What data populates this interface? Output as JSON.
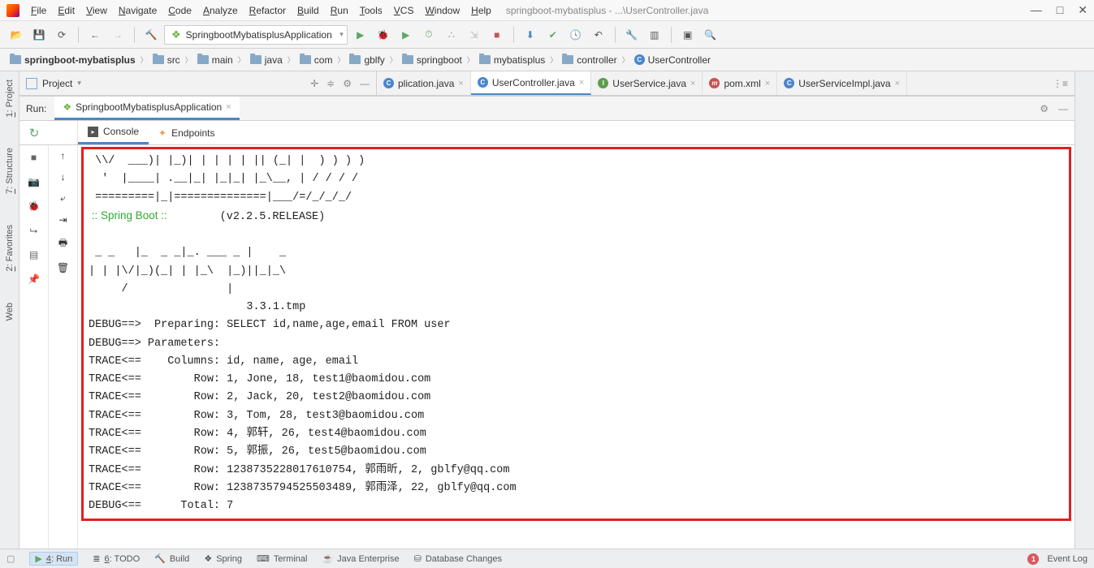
{
  "window": {
    "title_path": "springboot-mybatisplus - ...\\UserController.java"
  },
  "menu": [
    "File",
    "Edit",
    "View",
    "Navigate",
    "Code",
    "Analyze",
    "Refactor",
    "Build",
    "Run",
    "Tools",
    "VCS",
    "Window",
    "Help"
  ],
  "run_config": {
    "name": "SpringbootMybatisplusApplication"
  },
  "breadcrumb": [
    {
      "icon": "root",
      "label": "springboot-mybatisplus"
    },
    {
      "icon": "folder",
      "label": "src"
    },
    {
      "icon": "folder",
      "label": "main"
    },
    {
      "icon": "folder",
      "label": "java"
    },
    {
      "icon": "folder",
      "label": "com"
    },
    {
      "icon": "folder",
      "label": "gblfy"
    },
    {
      "icon": "folder",
      "label": "springboot"
    },
    {
      "icon": "folder",
      "label": "mybatisplus"
    },
    {
      "icon": "folder",
      "label": "controller"
    },
    {
      "icon": "class",
      "label": "UserController"
    }
  ],
  "project_panel": {
    "label": "Project"
  },
  "editor_tabs": [
    {
      "icon": "c",
      "label": "plication.java",
      "active": false,
      "truncated": true
    },
    {
      "icon": "c",
      "label": "UserController.java",
      "active": true
    },
    {
      "icon": "i",
      "label": "UserService.java",
      "active": false
    },
    {
      "icon": "m",
      "label": "pom.xml",
      "active": false
    },
    {
      "icon": "c",
      "label": "UserServiceImpl.java",
      "active": false
    }
  ],
  "left_tabs": [
    {
      "label": "1: Project",
      "tip": "1"
    },
    {
      "label": "7: Structure",
      "tip": "7"
    },
    {
      "label": "2: Favorites",
      "tip": "2"
    },
    {
      "label": "Web",
      "tip": ""
    }
  ],
  "run_panel": {
    "title": "Run:",
    "config": "SpringbootMybatisplusApplication",
    "subtabs": [
      {
        "label": "Console",
        "active": true
      },
      {
        "label": "Endpoints",
        "active": false
      }
    ]
  },
  "console": {
    "banner": " \\\\/  ___)| |_)| | | | | || (_| |  ) ) ) )\n  '  |____| .__|_| |_|_| |_\\__, | / / / /\n =========|_|==============|___/=/_/_/_/",
    "spring_label": " :: Spring Boot ::",
    "spring_version": "        (v2.2.5.RELEASE)",
    "divider": "\n _ _   |_  _ _|_. ___ _ |    _\n| | |\\/|_)(_| | |_\\  |_)||_|_\\\n     /               |\n                        3.3.1.tmp",
    "lines": [
      "DEBUG==>  Preparing: SELECT id,name,age,email FROM user",
      "DEBUG==> Parameters:",
      "TRACE<==    Columns: id, name, age, email",
      "TRACE<==        Row: 1, Jone, 18, test1@baomidou.com",
      "TRACE<==        Row: 2, Jack, 20, test2@baomidou.com",
      "TRACE<==        Row: 3, Tom, 28, test3@baomidou.com",
      "TRACE<==        Row: 4, 郭轩, 26, test4@baomidou.com",
      "TRACE<==        Row: 5, 郭振, 26, test5@baomidou.com",
      "TRACE<==        Row: 1238735228017610754, 郭雨昕, 2, gblfy@qq.com",
      "TRACE<==        Row: 1238735794525503489, 郭雨泽, 22, gblfy@qq.com",
      "DEBUG<==      Total: 7"
    ]
  },
  "statusbar": {
    "items": [
      {
        "label": "4: Run",
        "active": true
      },
      {
        "label": "6: TODO"
      },
      {
        "label": "Build"
      },
      {
        "label": "Spring"
      },
      {
        "label": "Terminal"
      },
      {
        "label": "Java Enterprise"
      },
      {
        "label": "Database Changes"
      }
    ],
    "event_count": "1",
    "event_log": "Event Log"
  }
}
